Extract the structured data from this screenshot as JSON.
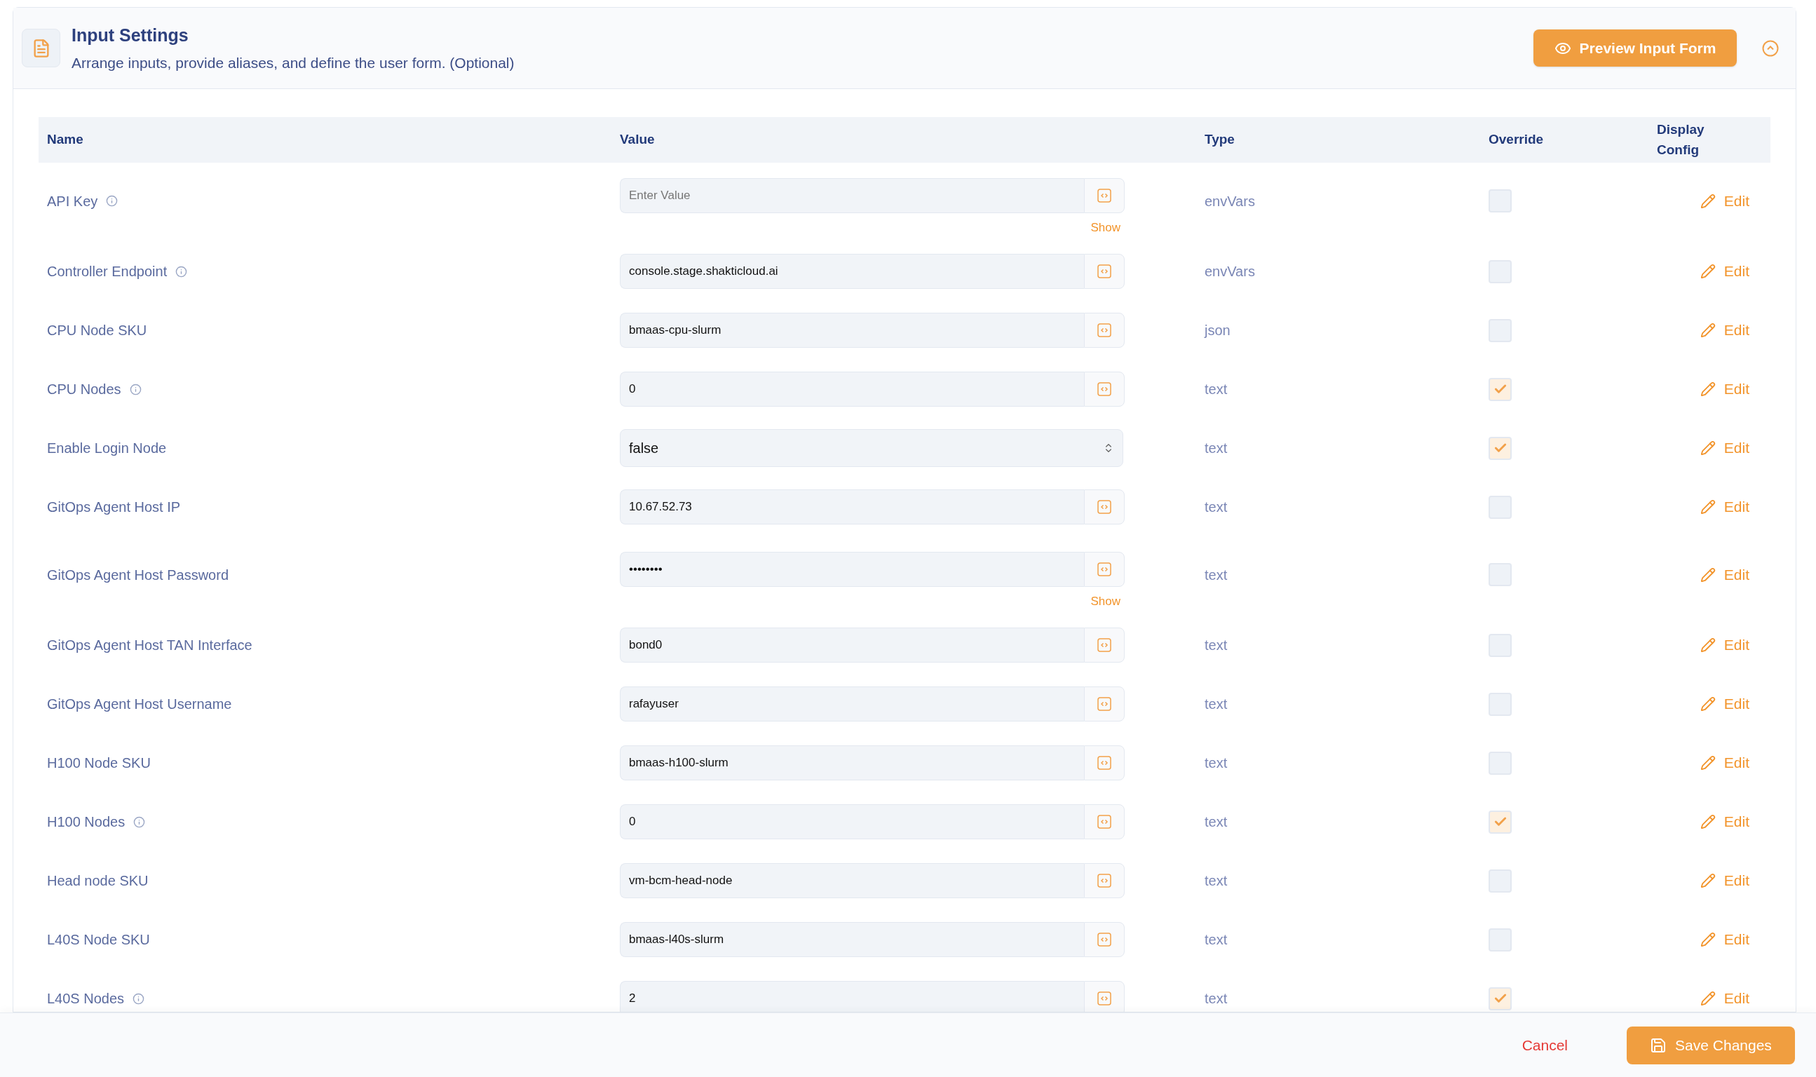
{
  "header": {
    "title": "Input Settings",
    "subtitle": "Arrange inputs, provide aliases, and define the user form. (Optional)",
    "preview_button": "Preview Input Form"
  },
  "table": {
    "columns": [
      "Name",
      "Value",
      "Type",
      "Override",
      "Display Config"
    ],
    "rows": [
      {
        "name": "API Key",
        "info": true,
        "kind": "password",
        "placeholder": "Enter Value",
        "show": "Show",
        "type": "envVars",
        "override": false,
        "action": "Edit"
      },
      {
        "name": "Controller Endpoint",
        "info": true,
        "kind": "input",
        "value": "console.stage.shakticloud.ai",
        "type": "envVars",
        "override": false,
        "action": "Edit"
      },
      {
        "name": "CPU Node SKU",
        "info": false,
        "kind": "input",
        "value": "bmaas-cpu-slurm",
        "type": "json",
        "override": false,
        "action": "Edit"
      },
      {
        "name": "CPU Nodes",
        "info": true,
        "kind": "input",
        "value": "0",
        "type": "text",
        "override": true,
        "action": "Edit"
      },
      {
        "name": "Enable Login Node",
        "info": false,
        "kind": "select",
        "value": "false",
        "type": "text",
        "override": true,
        "action": "Edit"
      },
      {
        "name": "GitOps Agent Host IP",
        "info": false,
        "kind": "input",
        "value": "10.67.52.73",
        "type": "text",
        "override": false,
        "action": "Edit"
      },
      {
        "name": "GitOps Agent Host Password",
        "info": false,
        "kind": "password",
        "value": "••••••••",
        "show": "Show",
        "type": "text",
        "override": false,
        "action": "Edit"
      },
      {
        "name": "GitOps Agent Host TAN Interface",
        "info": false,
        "kind": "input",
        "value": "bond0",
        "type": "text",
        "override": false,
        "action": "Edit"
      },
      {
        "name": "GitOps Agent Host Username",
        "info": false,
        "kind": "input",
        "value": "rafayuser",
        "type": "text",
        "override": false,
        "action": "Edit"
      },
      {
        "name": "H100 Node SKU",
        "info": false,
        "kind": "input",
        "value": "bmaas-h100-slurm",
        "type": "text",
        "override": false,
        "action": "Edit"
      },
      {
        "name": "H100 Nodes",
        "info": true,
        "kind": "input",
        "value": "0",
        "type": "text",
        "override": true,
        "action": "Edit"
      },
      {
        "name": "Head node SKU",
        "info": false,
        "kind": "input",
        "value": "vm-bcm-head-node",
        "type": "text",
        "override": false,
        "action": "Edit"
      },
      {
        "name": "L40S Node SKU",
        "info": false,
        "kind": "input",
        "value": "bmaas-l40s-slurm",
        "type": "text",
        "override": false,
        "action": "Edit"
      },
      {
        "name": "L40S Nodes",
        "info": true,
        "kind": "input",
        "value": "2",
        "type": "text",
        "override": true,
        "action": "Edit"
      }
    ]
  },
  "footer": {
    "cancel": "Cancel",
    "save": "Save Changes"
  }
}
